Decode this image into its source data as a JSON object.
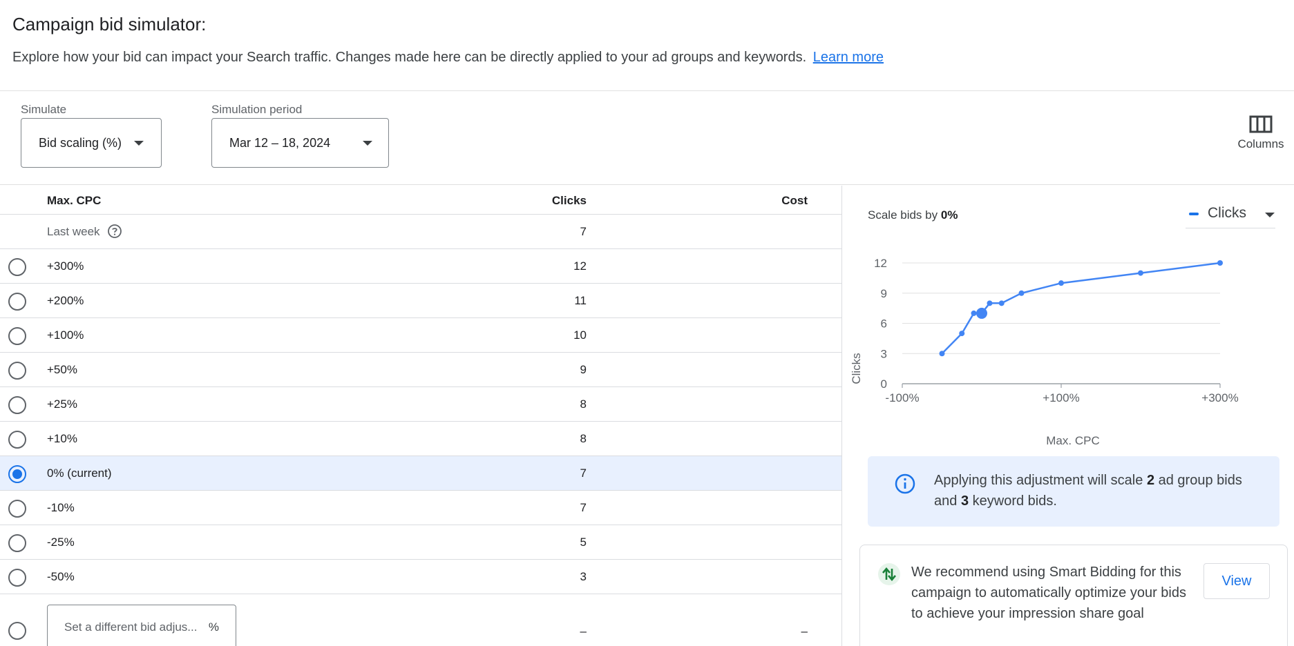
{
  "header": {
    "title": "Campaign bid simulator:",
    "description": "Explore how your bid can impact your Search traffic. Changes made here can be directly applied to your ad groups and keywords.",
    "learn_more": "Learn more"
  },
  "controls": {
    "simulate_label": "Simulate",
    "simulate_value": "Bid scaling (%)",
    "period_label": "Simulation period",
    "period_value": "Mar 12 – 18, 2024",
    "columns_label": "Columns"
  },
  "table": {
    "headers": {
      "max_cpc": "Max. CPC",
      "clicks": "Clicks",
      "cost": "Cost"
    },
    "last_week": {
      "label": "Last week",
      "clicks": "7"
    },
    "rows": [
      {
        "label": "+300%",
        "clicks": "12",
        "selected": false
      },
      {
        "label": "+200%",
        "clicks": "11",
        "selected": false
      },
      {
        "label": "+100%",
        "clicks": "10",
        "selected": false
      },
      {
        "label": "+50%",
        "clicks": "9",
        "selected": false
      },
      {
        "label": "+25%",
        "clicks": "8",
        "selected": false
      },
      {
        "label": "+10%",
        "clicks": "8",
        "selected": false
      },
      {
        "label": "0% (current)",
        "clicks": "7",
        "selected": true
      },
      {
        "label": "-10%",
        "clicks": "7",
        "selected": false
      },
      {
        "label": "-25%",
        "clicks": "5",
        "selected": false
      },
      {
        "label": "-50%",
        "clicks": "3",
        "selected": false
      }
    ],
    "custom": {
      "placeholder": "Set a different bid adjus...",
      "unit": "%",
      "clicks": "–",
      "cost": "–"
    }
  },
  "side_panel": {
    "scale_prefix": "Scale bids by",
    "scale_value": "0%",
    "metric_select": "Clicks",
    "info": {
      "part1": "Applying this adjustment will scale",
      "ad_groups": "2",
      "part2": "ad group bids and",
      "keywords": "3",
      "part3": "keyword bids."
    },
    "recommendation": {
      "text": "We recommend using Smart Bidding for this campaign to automatically optimize your bids to achieve your impression share goal",
      "button": "View"
    }
  },
  "colors": {
    "accent": "#1a73e8",
    "selected_row": "#e8f0fe",
    "info_bg": "#e8f0fe",
    "rec_icon": "#188038"
  },
  "icons": [
    "chevron-down-icon",
    "columns-icon",
    "help-icon",
    "info-icon",
    "smart-bidding-icon"
  ],
  "chart_data": {
    "type": "line",
    "xlabel": "Max. CPC",
    "ylabel": "Clicks",
    "ylim": [
      0,
      12
    ],
    "xlim": [
      -100,
      300
    ],
    "y_ticks": [
      0,
      3,
      6,
      9,
      12
    ],
    "x_ticks": [
      "-100%",
      "+100%",
      "+300%"
    ],
    "x_tick_values": [
      -100,
      100,
      300
    ],
    "grid": true,
    "series": [
      {
        "x": [
          -50,
          -25,
          -10,
          0,
          10,
          25,
          50,
          100,
          200,
          300
        ],
        "y": [
          3,
          5,
          7,
          7,
          8,
          8,
          9,
          10,
          11,
          12
        ]
      }
    ],
    "highlight": {
      "x": 0,
      "y": 7
    }
  }
}
